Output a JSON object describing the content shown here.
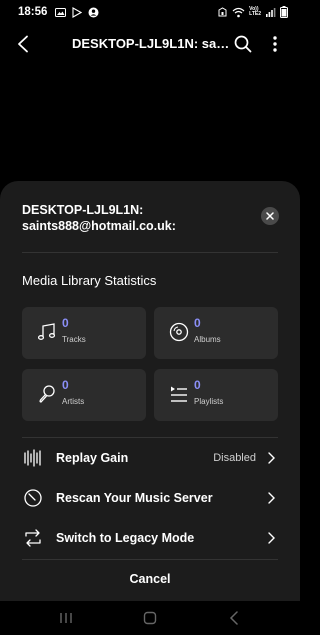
{
  "status_bar": {
    "time": "18:56",
    "network_label": "Vo))\nLTE2"
  },
  "top_bar": {
    "title": "DESKTOP-LJL9L1N: saints888@hotmail.co.uk:",
    "icons": {
      "back": "back-arrow-icon",
      "search": "search-icon",
      "more": "more-vert-icon"
    }
  },
  "sheet": {
    "title_line1": "DESKTOP-LJL9L1N:",
    "title_line2": "saints888@hotmail.co.uk:",
    "stats_heading": "Media Library Statistics",
    "stats": [
      {
        "value": "0",
        "label": "Tracks",
        "icon": "music-note-icon"
      },
      {
        "value": "0",
        "label": "Albums",
        "icon": "album-disc-icon"
      },
      {
        "value": "0",
        "label": "Artists",
        "icon": "microphone-icon"
      },
      {
        "value": "0",
        "label": "Playlists",
        "icon": "playlist-icon"
      }
    ],
    "menu": [
      {
        "label": "Replay Gain",
        "value": "Disabled",
        "icon": "waveform-icon"
      },
      {
        "label": "Rescan Your Music Server",
        "value": "",
        "icon": "rescan-icon"
      },
      {
        "label": "Switch to Legacy Mode",
        "value": "",
        "icon": "switch-icon"
      }
    ],
    "cancel_label": "Cancel"
  },
  "colors": {
    "background": "#000000",
    "sheet": "#1c1c1c",
    "card": "#2c2c2c",
    "accent": "#8b8ff8"
  }
}
